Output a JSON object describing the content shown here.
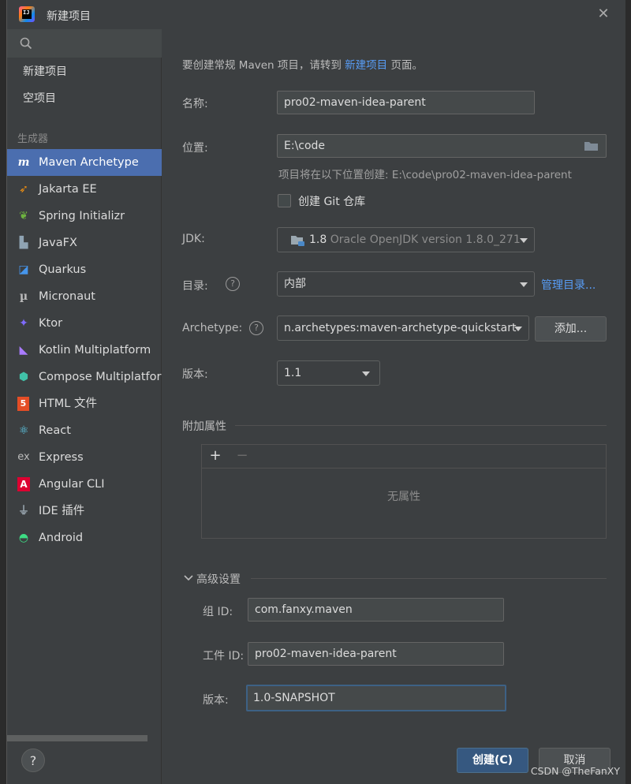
{
  "window": {
    "title": "新建项目",
    "close_glyph": "✕"
  },
  "sidebar": {
    "search_placeholder": "",
    "top_items": [
      {
        "label": "新建项目"
      },
      {
        "label": "空项目"
      }
    ],
    "group_label": "生成器",
    "generators": [
      {
        "label": "Maven Archetype",
        "icon": "maven-icon",
        "selected": true
      },
      {
        "label": "Jakarta EE",
        "icon": "jakarta-icon"
      },
      {
        "label": "Spring Initializr",
        "icon": "spring-icon"
      },
      {
        "label": "JavaFX",
        "icon": "javafx-icon"
      },
      {
        "label": "Quarkus",
        "icon": "quarkus-icon"
      },
      {
        "label": "Micronaut",
        "icon": "micronaut-icon"
      },
      {
        "label": "Ktor",
        "icon": "ktor-icon"
      },
      {
        "label": "Kotlin Multiplatform",
        "icon": "kotlin-icon"
      },
      {
        "label": "Compose Multiplatform",
        "icon": "compose-icon"
      },
      {
        "label": "HTML 文件",
        "icon": "html5-icon"
      },
      {
        "label": "React",
        "icon": "react-icon"
      },
      {
        "label": "Express",
        "icon": "express-icon"
      },
      {
        "label": "Angular CLI",
        "icon": "angular-icon"
      },
      {
        "label": "IDE 插件",
        "icon": "plugin-icon"
      },
      {
        "label": "Android",
        "icon": "android-icon"
      }
    ],
    "help_glyph": "?"
  },
  "form": {
    "hint_prefix": "要创建常规 Maven 项目，请转到 ",
    "hint_link": "新建项目",
    "hint_suffix": " 页面。",
    "name_label": "名称:",
    "name_value": "pro02-maven-idea-parent",
    "location_label": "位置:",
    "location_value": "E:\\code",
    "location_hint": "项目将在以下位置创建: E:\\code\\pro02-maven-idea-parent",
    "git_label": "创建 Git 仓库",
    "git_checked": false,
    "jdk_label": "JDK:",
    "jdk_version": "1.8",
    "jdk_desc": "Oracle OpenJDK version 1.8.0_271",
    "catalog_label": "目录:",
    "catalog_value": "内部",
    "catalog_manage": "管理目录...",
    "archetype_label": "Archetype:",
    "archetype_value": "n.archetypes:maven-archetype-quickstart",
    "archetype_add": "添加...",
    "version_label": "版本:",
    "version_value": "1.1",
    "props_label": "附加属性",
    "props_add": "+",
    "props_remove": "−",
    "props_empty": "无属性",
    "advanced_label": "高级设置",
    "group_id_label": "组 ID:",
    "group_id_value": "com.fanxy.maven",
    "artifact_id_label": "工件 ID:",
    "artifact_id_value": "pro02-maven-idea-parent",
    "adv_version_label": "版本:",
    "adv_version_value": "1.0-SNAPSHOT"
  },
  "footer": {
    "create_label": "创建(C)",
    "cancel_label": "取消"
  },
  "watermark": "CSDN @TheFanXY",
  "colors": {
    "accent": "#4b6eaf",
    "link": "#589df6",
    "primary_button": "#365880"
  }
}
